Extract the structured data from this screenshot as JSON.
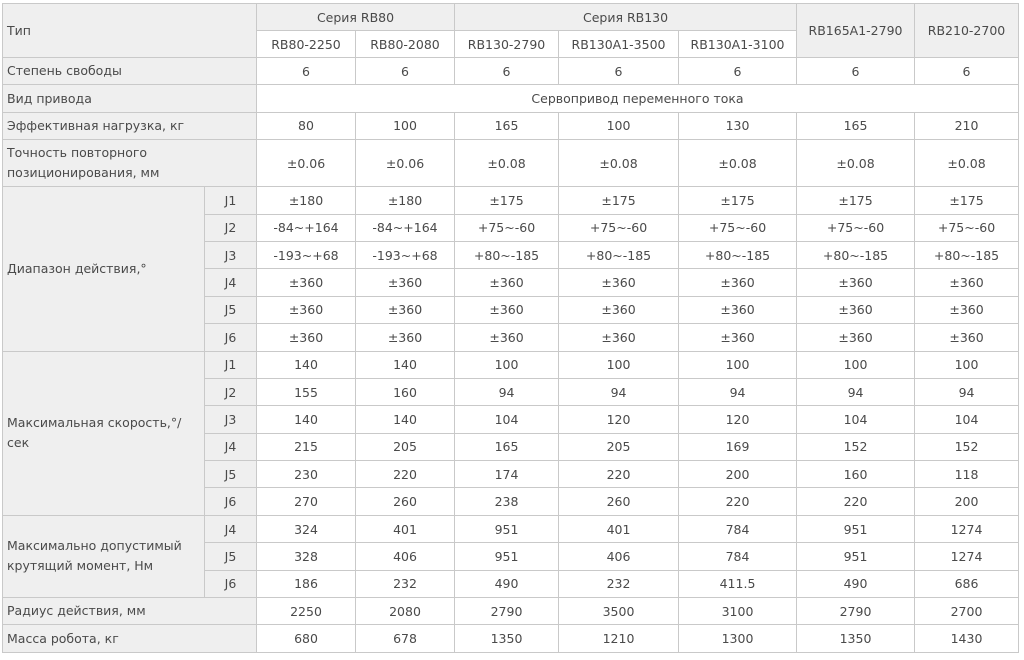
{
  "header": {
    "type_label": "Тип",
    "series": [
      {
        "name": "Серия RB80",
        "models": [
          "RB80-2250",
          "RB80-2080"
        ]
      },
      {
        "name": "Серия RB130",
        "models": [
          "RB130-2790",
          "RB130A1-3500",
          "RB130A1-3100"
        ]
      }
    ],
    "single_models": [
      "RB165A1-2790",
      "RB210-2700"
    ]
  },
  "rows": {
    "dof": {
      "label": "Степень свободы",
      "values": [
        "6",
        "6",
        "6",
        "6",
        "6",
        "6",
        "6"
      ]
    },
    "drive": {
      "label": "Вид привода",
      "value": "Сервопривод переменного тока"
    },
    "payload": {
      "label": "Эффективная нагрузка, кг",
      "values": [
        "80",
        "100",
        "165",
        "100",
        "130",
        "165",
        "210"
      ]
    },
    "repeatability": {
      "label": "Точность повторного позиционирования, мм",
      "values": [
        "±0.06",
        "±0.06",
        "±0.08",
        "±0.08",
        "±0.08",
        "±0.08",
        "±0.08"
      ]
    }
  },
  "groups": {
    "range": {
      "label": "Диапазон действия,°",
      "joints": [
        {
          "joint": "J1",
          "values": [
            "±180",
            "±180",
            "±175",
            "±175",
            "±175",
            "±175",
            "±175"
          ]
        },
        {
          "joint": "J2",
          "values": [
            "-84~+164",
            "-84~+164",
            "+75~-60",
            "+75~-60",
            "+75~-60",
            "+75~-60",
            "+75~-60"
          ]
        },
        {
          "joint": "J3",
          "values": [
            "-193~+68",
            "-193~+68",
            "+80~-185",
            "+80~-185",
            "+80~-185",
            "+80~-185",
            "+80~-185"
          ]
        },
        {
          "joint": "J4",
          "values": [
            "±360",
            "±360",
            "±360",
            "±360",
            "±360",
            "±360",
            "±360"
          ]
        },
        {
          "joint": "J5",
          "values": [
            "±360",
            "±360",
            "±360",
            "±360",
            "±360",
            "±360",
            "±360"
          ]
        },
        {
          "joint": "J6",
          "values": [
            "±360",
            "±360",
            "±360",
            "±360",
            "±360",
            "±360",
            "±360"
          ]
        }
      ]
    },
    "speed": {
      "label": "Максимальная скорость,°/сек",
      "joints": [
        {
          "joint": "J1",
          "values": [
            "140",
            "140",
            "100",
            "100",
            "100",
            "100",
            "100"
          ]
        },
        {
          "joint": "J2",
          "values": [
            "155",
            "160",
            "94",
            "94",
            "94",
            "94",
            "94"
          ]
        },
        {
          "joint": "J3",
          "values": [
            "140",
            "140",
            "104",
            "120",
            "120",
            "104",
            "104"
          ]
        },
        {
          "joint": "J4",
          "values": [
            "215",
            "205",
            "165",
            "205",
            "169",
            "152",
            "152"
          ]
        },
        {
          "joint": "J5",
          "values": [
            "230",
            "220",
            "174",
            "220",
            "200",
            "160",
            "118"
          ]
        },
        {
          "joint": "J6",
          "values": [
            "270",
            "260",
            "238",
            "260",
            "220",
            "220",
            "200"
          ]
        }
      ]
    },
    "torque": {
      "label": "Максимально допустимый крутящий момент, Нм",
      "joints": [
        {
          "joint": "J4",
          "values": [
            "324",
            "401",
            "951",
            "401",
            "784",
            "951",
            "1274"
          ]
        },
        {
          "joint": "J5",
          "values": [
            "328",
            "406",
            "951",
            "406",
            "784",
            "951",
            "1274"
          ]
        },
        {
          "joint": "J6",
          "values": [
            "186",
            "232",
            "490",
            "232",
            "411.5",
            "490",
            "686"
          ]
        }
      ]
    }
  },
  "footer_rows": {
    "reach": {
      "label": "Радиус действия, мм",
      "values": [
        "2250",
        "2080",
        "2790",
        "3500",
        "3100",
        "2790",
        "2700"
      ]
    },
    "mass": {
      "label": "Масса робота, кг",
      "values": [
        "680",
        "678",
        "1350",
        "1210",
        "1300",
        "1350",
        "1430"
      ]
    }
  }
}
